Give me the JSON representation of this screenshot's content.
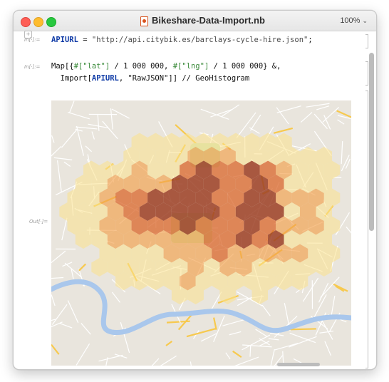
{
  "window": {
    "title": "Bikeshare-Data-Import.nb",
    "zoom": "100%",
    "zoom_icon": "chevron-down-icon"
  },
  "cell1": {
    "in_label": "In[·]:=",
    "code_var": "APIURL",
    "code_eq": " = ",
    "code_str": "\"http://api.citybik.es/barclays-cycle-hire.json\"",
    "code_end": ";"
  },
  "cell2": {
    "in_label": "In[·]:=",
    "line1_a": "Map[{",
    "line1_b": "#[\"lat\"]",
    "line1_c": " / 1 000 000, ",
    "line1_d": "#[\"lng\"]",
    "line1_e": " / 1 000 000} &,",
    "line2_a": "  Import[",
    "line2_b": "APIURL",
    "line2_c": ", \"RawJSON\"]] // GeoHistogram"
  },
  "output": {
    "out_label": "Out[·]=",
    "map_content": "GeoHistogram hexagonal density map of bike stations over London street map",
    "colors": {
      "low": "#fbe28a",
      "mid": "#f2a04a",
      "high": "#d9652a",
      "peak": "#9c4024",
      "river": "#a9c7ec",
      "park": "#cfe3b8",
      "road": "#f7c94e"
    }
  }
}
